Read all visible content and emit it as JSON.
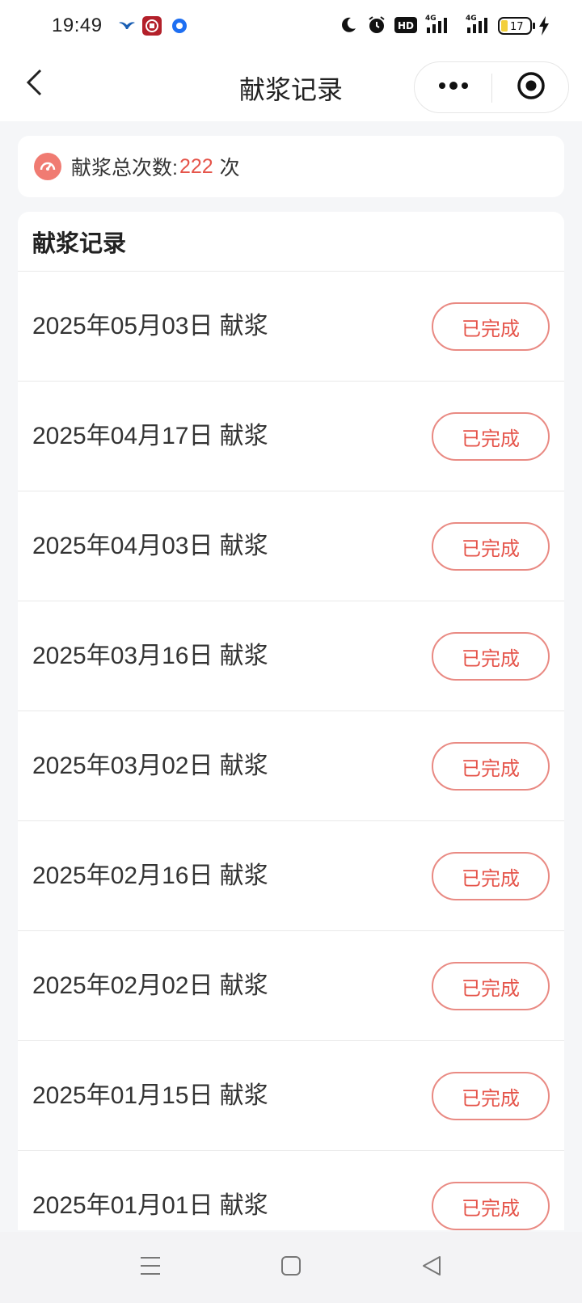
{
  "status_bar": {
    "time": "19:49",
    "battery": "17",
    "network": "4G",
    "icons": [
      "bird-icon",
      "bank-app-icon",
      "circle-app-icon",
      "moon-icon",
      "alarm-icon",
      "hd-icon",
      "signal-icon",
      "battery-icon",
      "charging-icon"
    ]
  },
  "nav": {
    "title": "献浆记录",
    "back_icon": "chevron-left-icon",
    "more_icon": "more-dots-icon",
    "close_icon": "target-close-icon"
  },
  "summary": {
    "label": "献浆总次数:",
    "value": "222",
    "unit": "次",
    "icon": "gauge-icon",
    "accent_color": "#e5544a"
  },
  "records": {
    "title": "献浆记录",
    "items": [
      {
        "label": "2025年05月03日 献浆",
        "status": "已完成"
      },
      {
        "label": "2025年04月17日 献浆",
        "status": "已完成"
      },
      {
        "label": "2025年04月03日 献浆",
        "status": "已完成"
      },
      {
        "label": "2025年03月16日 献浆",
        "status": "已完成"
      },
      {
        "label": "2025年03月02日 献浆",
        "status": "已完成"
      },
      {
        "label": "2025年02月16日 献浆",
        "status": "已完成"
      },
      {
        "label": "2025年02月02日 献浆",
        "status": "已完成"
      },
      {
        "label": "2025年01月15日 献浆",
        "status": "已完成"
      },
      {
        "label": "2025年01月01日 献浆",
        "status": "已完成"
      }
    ]
  },
  "system_nav": {
    "icons": [
      "menu-icon",
      "home-square-icon",
      "back-triangle-icon"
    ]
  }
}
